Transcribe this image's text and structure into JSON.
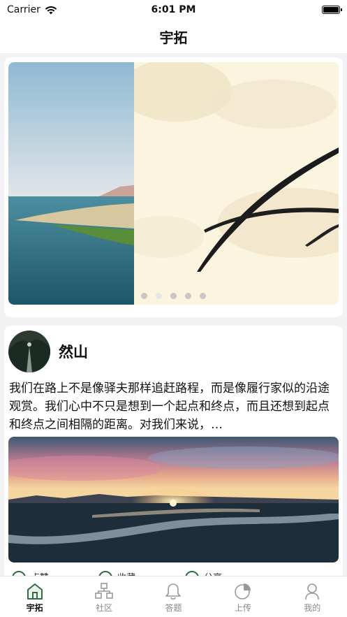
{
  "status_bar": {
    "carrier": "Carrier",
    "time": "6:01 PM"
  },
  "nav": {
    "title": "宇拓"
  },
  "banner": {
    "dot_count": 5,
    "active_dot": 1
  },
  "post": {
    "author": "然山",
    "text": "我们在路上不是像驿夫那样追赶路程，而是像履行家似的沿途观赏。我们心中不只是想到一个起点和终点，而且还想到起点和终点之间相隔的距离。对我们来说，…",
    "actions": [
      "点赞",
      "收藏",
      "分享"
    ]
  },
  "tabs": [
    {
      "label": "宇拓",
      "icon": "home-icon",
      "active": true
    },
    {
      "label": "社区",
      "icon": "community-icon",
      "active": false
    },
    {
      "label": "答题",
      "icon": "bell-icon",
      "active": false
    },
    {
      "label": "上传",
      "icon": "upload-pie-icon",
      "active": false
    },
    {
      "label": "我的",
      "icon": "profile-icon",
      "active": false
    }
  ],
  "colors": {
    "accent": "#2f6e45",
    "background": "#f2f2f4"
  }
}
